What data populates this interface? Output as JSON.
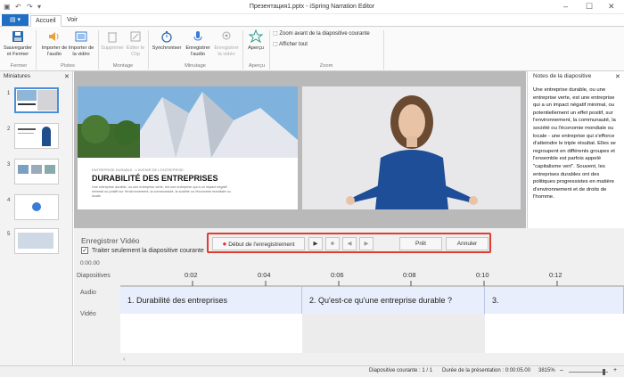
{
  "window": {
    "title": "Презентация1.pptx - iSpring Narration Editor"
  },
  "menu": {
    "file_label": "",
    "tabs": [
      "Accueil",
      "Voir"
    ]
  },
  "ribbon": {
    "buttons": {
      "save_close": "Sauvegarder et Fermer",
      "import_audio": "Importer de l'audio",
      "import_video": "Importer de la vidéo",
      "delete": "Supprimer",
      "edit_clip": "Éditer le Clip",
      "sync": "Synchroniser",
      "record_audio": "Enregistrer l'audio",
      "record_video": "Enregistrer la vidéo",
      "preview": "Aperçu",
      "zoom_fit": "Zoom avant de la diapositive courante",
      "show_all": "Afficher tout"
    },
    "groups": [
      "Fermer",
      "Pistes",
      "Montage",
      "Minutage",
      "Aperçu",
      "Zoom"
    ]
  },
  "thumbnails": {
    "title": "Miniatures",
    "slides": [
      "1",
      "2",
      "3",
      "4",
      "5"
    ]
  },
  "slide": {
    "subtitle": "ENTREPRISE DURABLE : L'AVENIR DE L'ENTREPRISE",
    "title": "DURABILITÉ DES ENTREPRISES",
    "body": "Une entreprise durable, ou une entreprise verte, est une entreprise qui a un impact négatif minimal ou positif sur l'environnement, la communauté, la société ou l'économie mondiale ou locale"
  },
  "notes": {
    "title": "Notes de la diapositive",
    "text": "Une entreprise durable, ou une entreprise verte, est une entreprise qui a un impact négatif minimal, ou potentiellement un effet positif, sur l'environnement, la communauté, la société ou l'économie mondiale ou locale - une entreprise qui s'efforce d'atteindre le triple résultat. Elles se regroupent en différents groupes et l'ensemble est parfois appelé \"capitalisme vert\". Souvent, les entreprises durables ont des politiques progressistes en matière d'environnement et de droits de l'homme."
  },
  "record": {
    "title": "Enregistrer Vidéo",
    "checkbox_label": "Traiter seulement la diapositive courante",
    "checked": true,
    "start_label": "Début de l'enregistrement",
    "ready_label": "Prêt",
    "cancel_label": "Annuler"
  },
  "timeline": {
    "time": "0:00.00",
    "tracks": [
      "Diapositives",
      "Audio",
      "Vidéo"
    ],
    "ticks": [
      "0:02",
      "0:04",
      "0:06",
      "0:08",
      "0:10",
      "0:12"
    ],
    "segments": [
      "1. Durabilité des entreprises",
      "2. Qu'est-ce qu'une entreprise durable ?",
      "3."
    ]
  },
  "status": {
    "slide": "Diapositive courante : 1 / 1",
    "duration": "Durée de la présentation : 0:00:05.00",
    "zoom": "3815%"
  },
  "colors": {
    "accent": "#1f6fc5",
    "highlight": "#e03c31",
    "record_dot": "#e0322b"
  }
}
